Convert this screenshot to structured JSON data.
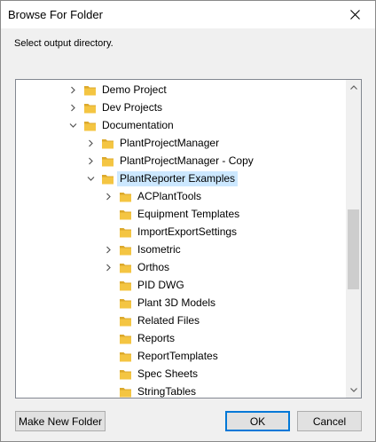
{
  "window": {
    "title": "Browse For Folder",
    "close_icon": "close-icon"
  },
  "instruction": "Select output directory.",
  "tree": {
    "items": [
      {
        "label": "Demo Project",
        "depth": 0,
        "expander": "collapsed"
      },
      {
        "label": "Dev Projects",
        "depth": 0,
        "expander": "collapsed"
      },
      {
        "label": "Documentation",
        "depth": 0,
        "expander": "expanded"
      },
      {
        "label": "PlantProjectManager",
        "depth": 1,
        "expander": "collapsed"
      },
      {
        "label": "PlantProjectManager - Copy",
        "depth": 1,
        "expander": "collapsed"
      },
      {
        "label": "PlantReporter Examples",
        "depth": 1,
        "expander": "expanded",
        "selected": true
      },
      {
        "label": "ACPlantTools",
        "depth": 2,
        "expander": "collapsed"
      },
      {
        "label": "Equipment Templates",
        "depth": 2,
        "expander": "none"
      },
      {
        "label": "ImportExportSettings",
        "depth": 2,
        "expander": "none"
      },
      {
        "label": "Isometric",
        "depth": 2,
        "expander": "collapsed"
      },
      {
        "label": "Orthos",
        "depth": 2,
        "expander": "collapsed"
      },
      {
        "label": "PID DWG",
        "depth": 2,
        "expander": "none"
      },
      {
        "label": "Plant 3D Models",
        "depth": 2,
        "expander": "none"
      },
      {
        "label": "Related Files",
        "depth": 2,
        "expander": "none"
      },
      {
        "label": "Reports",
        "depth": 2,
        "expander": "none"
      },
      {
        "label": "ReportTemplates",
        "depth": 2,
        "expander": "none"
      },
      {
        "label": "Spec Sheets",
        "depth": 2,
        "expander": "none"
      },
      {
        "label": "StringTables",
        "depth": 2,
        "expander": "none"
      }
    ],
    "scroll_position": 0.55
  },
  "buttons": {
    "new_folder": "Make New Folder",
    "ok": "OK",
    "cancel": "Cancel"
  },
  "colors": {
    "folder": "#f4c542",
    "folder_dark": "#dca92c",
    "selection": "#cce8ff",
    "default_button_border": "#0078d7"
  }
}
